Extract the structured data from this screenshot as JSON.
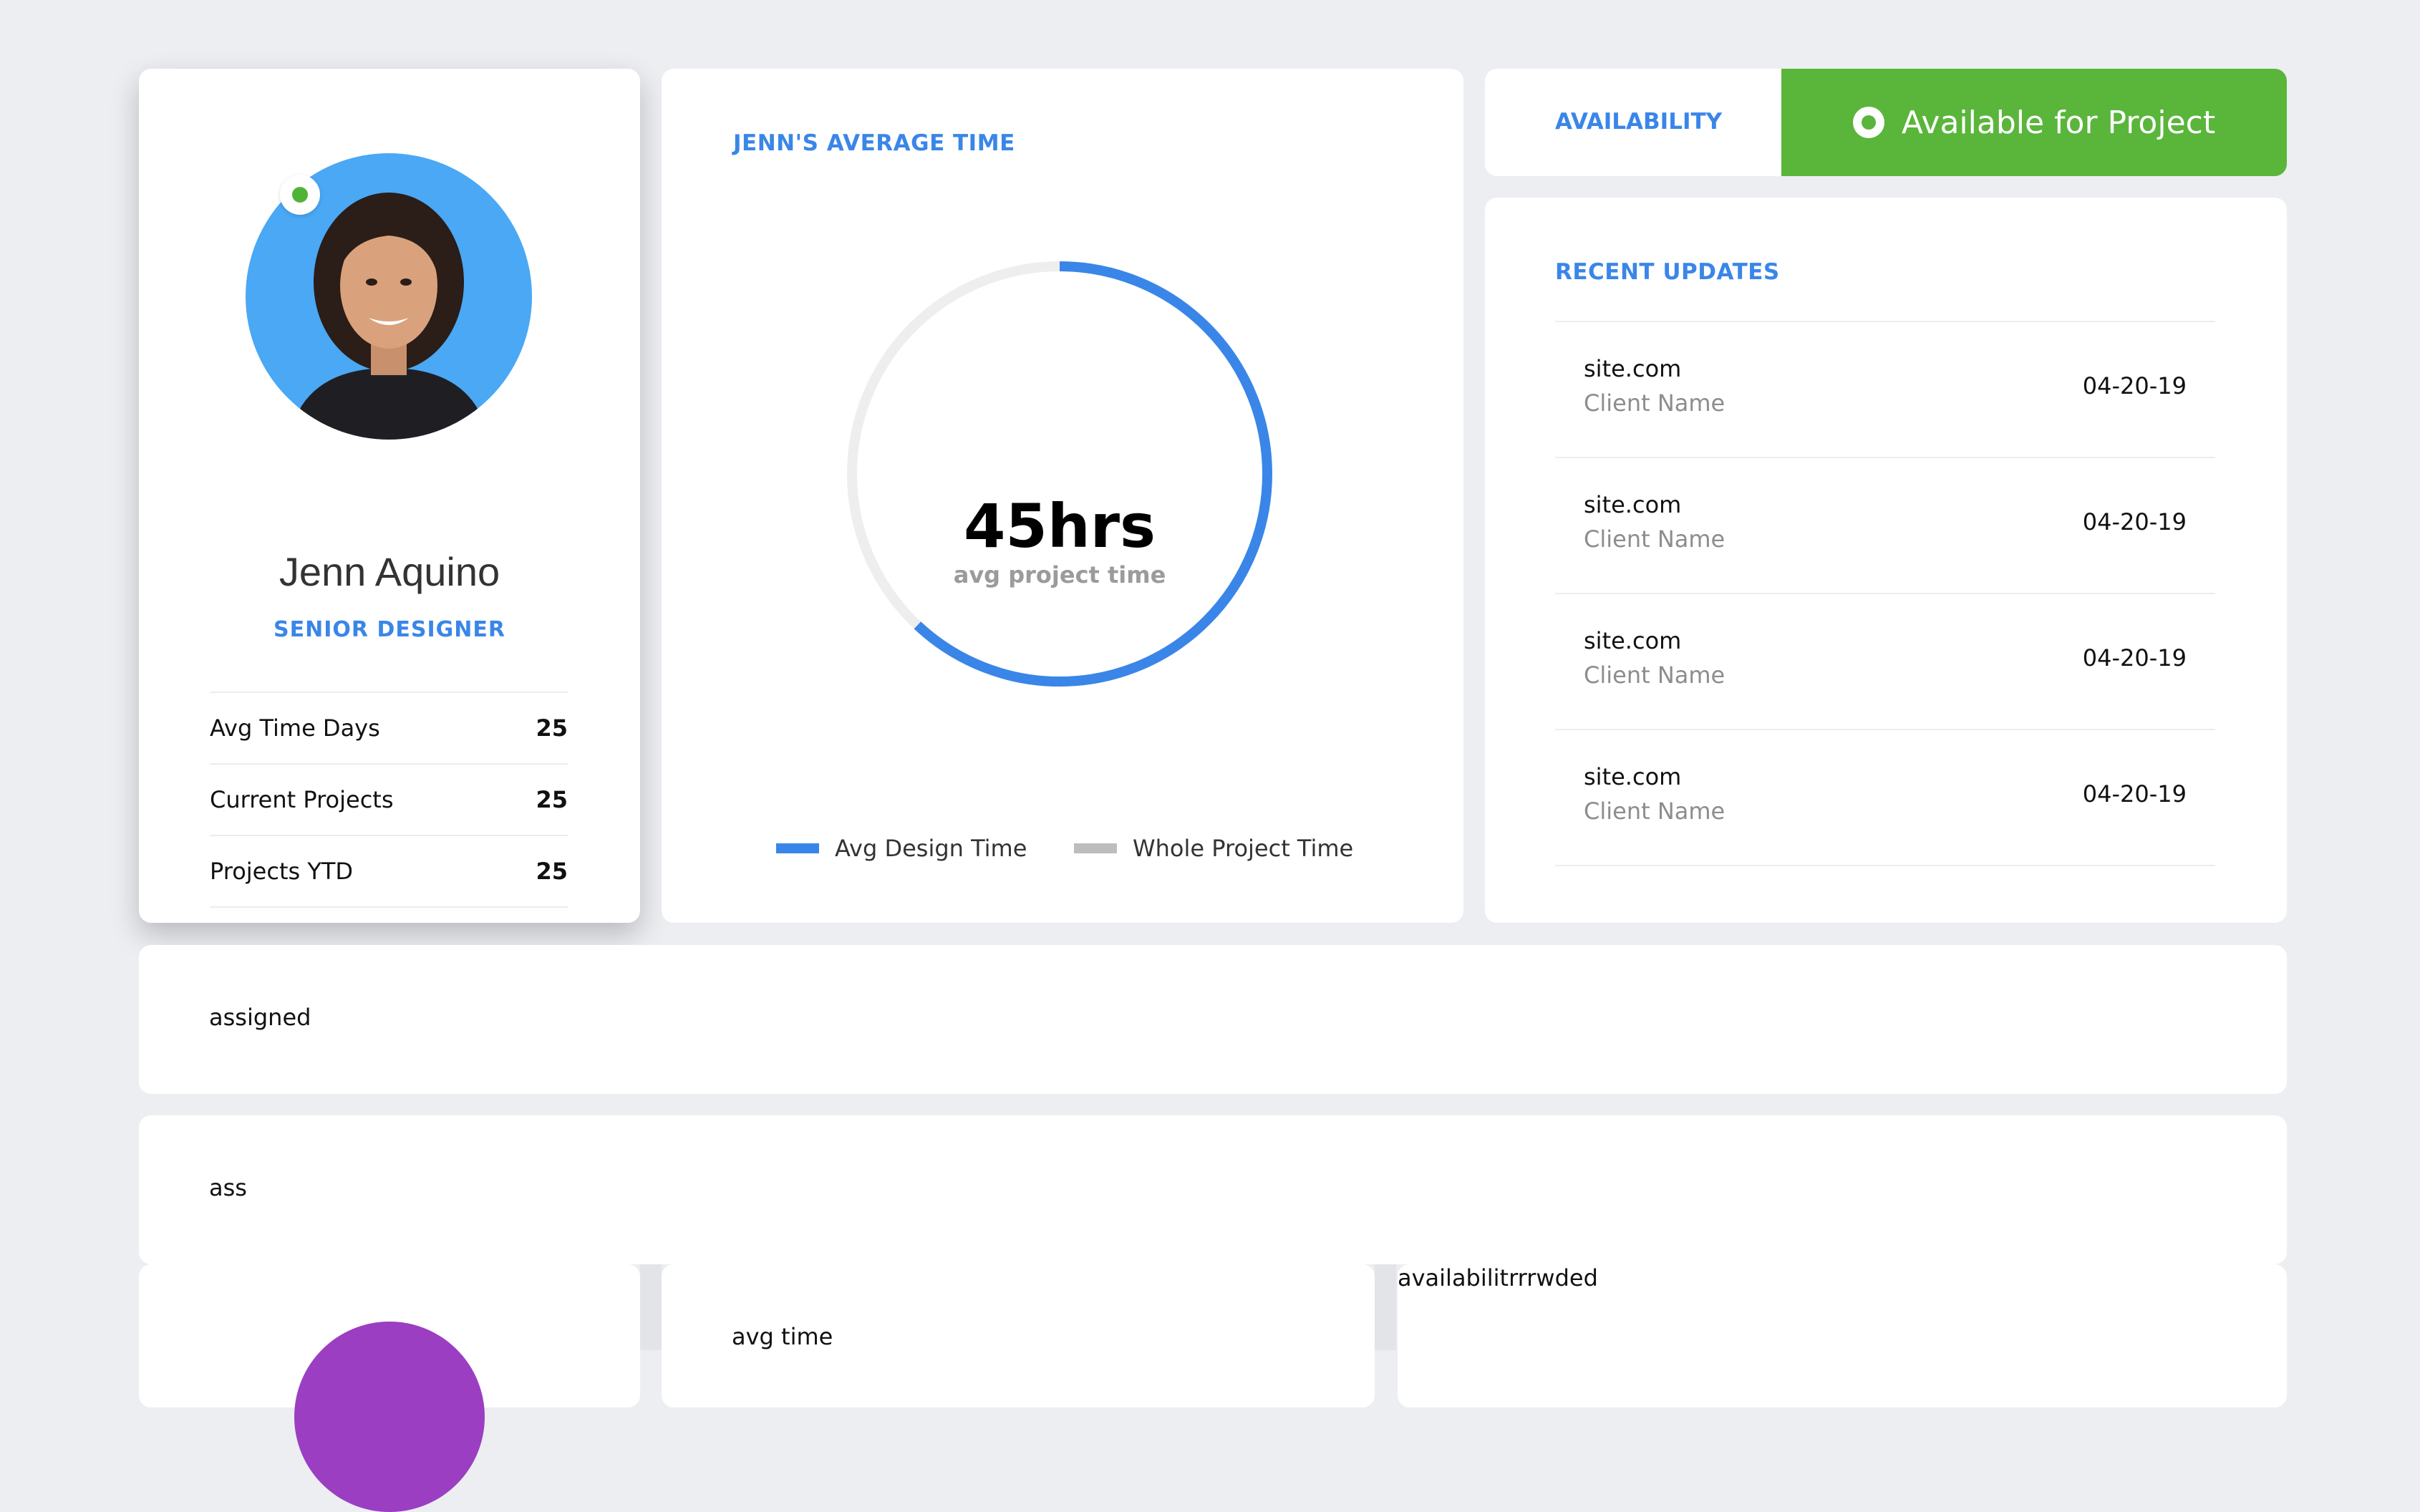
{
  "profile": {
    "name": "Jenn Aquino",
    "role": "SENIOR DESIGNER",
    "stats": [
      {
        "label": "Avg Time Days",
        "value": "25"
      },
      {
        "label": "Current Projects",
        "value": "25"
      },
      {
        "label": "Projects YTD",
        "value": "25"
      }
    ]
  },
  "avg_time": {
    "title": "JENN'S AVERAGE TIME",
    "value": "45hrs",
    "subtitle": "avg project time",
    "design_fraction": 0.62,
    "legend": [
      {
        "label": "Avg Design Time",
        "color": "#3a86e8"
      },
      {
        "label": "Whole Project Time",
        "color": "#bdbdbd"
      }
    ]
  },
  "availability": {
    "label": "AVAILABILITY",
    "status": "Available for Project",
    "status_color": "#5ab53b"
  },
  "updates": {
    "title": "RECENT UPDATES",
    "items": [
      {
        "site": "site.com",
        "client": "Client Name",
        "date": "04-20-19"
      },
      {
        "site": "site.com",
        "client": "Client Name",
        "date": "04-20-19"
      },
      {
        "site": "site.com",
        "client": "Client Name",
        "date": "04-20-19"
      },
      {
        "site": "site.com",
        "client": "Client Name",
        "date": "04-20-19"
      }
    ]
  },
  "panels": {
    "assigned": "assigned",
    "ass": "ass",
    "avg_time_label": "avg time",
    "availability_label": "availabilitrrrwded"
  },
  "colors": {
    "accent": "#3a86e8",
    "available": "#5ab53b",
    "avatar_bg": "#4aa8f5",
    "avatar2_bg": "#9b3ec2"
  }
}
